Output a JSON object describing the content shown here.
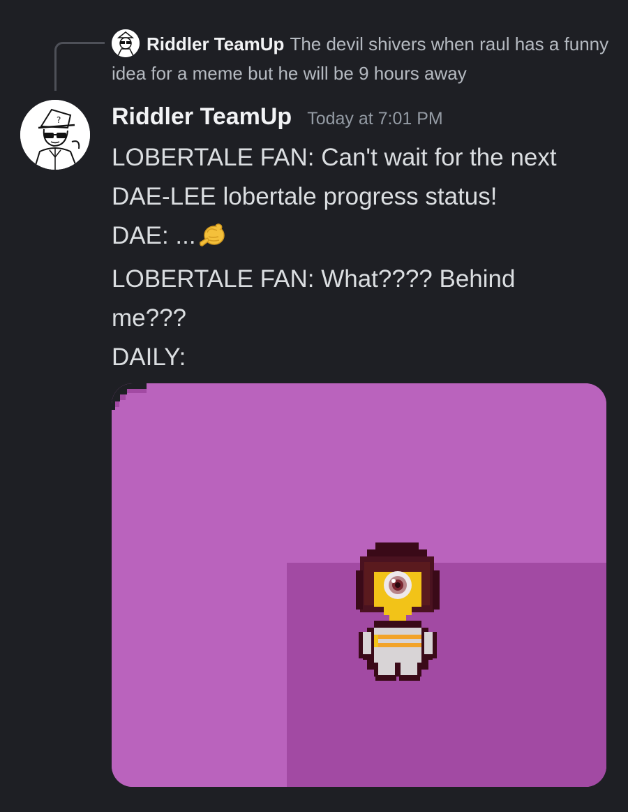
{
  "reply": {
    "author": "Riddler TeamUp",
    "text": "The devil shivers when raul has a funny idea for a meme but he will be 9 hours away"
  },
  "message": {
    "author": "Riddler TeamUp",
    "timestamp": "Today at 7:01 PM",
    "lines": [
      "LOBERTALE FAN: Can't wait for the next",
      "DAE-LEE lobertale progress status!",
      "DAE: ...",
      "LOBERTALE FAN: What???? Behind",
      "me???",
      "DAILY:"
    ],
    "emoji": "pointing-finger-emoji"
  },
  "attachment": {
    "type": "pixel-art-image",
    "background_color": "#ba63bd",
    "floor_color": "#a24aa3"
  }
}
